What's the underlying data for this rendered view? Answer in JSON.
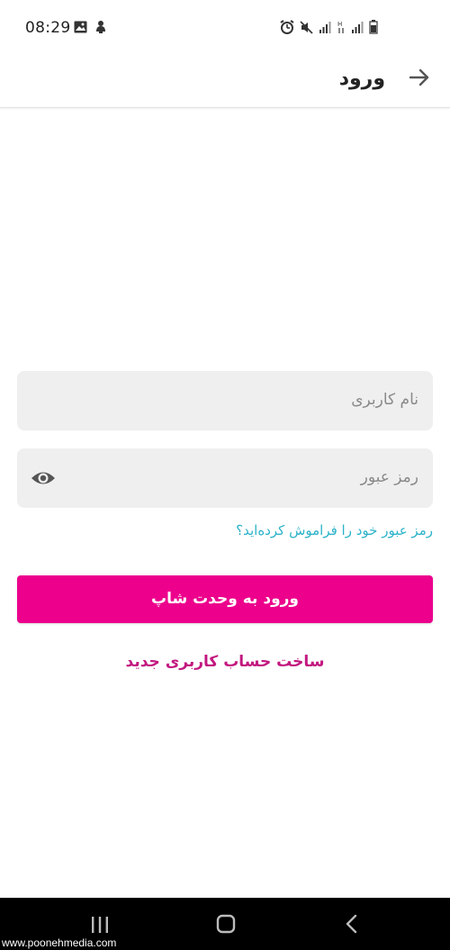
{
  "status_bar": {
    "time": "08:29",
    "left_icons": [
      "image-icon",
      "user-bell-icon"
    ],
    "right_icons": [
      "alarm-icon",
      "mute-icon",
      "signal-icon",
      "data-icon",
      "signal-icon",
      "battery-icon"
    ]
  },
  "app_bar": {
    "title": "ورود",
    "back_icon": "arrow-right-icon"
  },
  "form": {
    "username_placeholder": "نام کاربری",
    "password_placeholder": "رمز عبور",
    "forgot_password": "رمز عبور خود را فراموش کرده‌اید؟",
    "login_button": "ورود به وحدت شاپ",
    "register_link": "ساخت حساب کاربری جدید"
  },
  "colors": {
    "primary": "#ec008c",
    "register_text": "#c2177f",
    "link": "#2cb3c9",
    "field_bg": "#efefef"
  },
  "nav_bar": {
    "icons": [
      "recents-icon",
      "home-icon",
      "back-icon"
    ]
  },
  "watermark": "www.poonehmedia.com"
}
